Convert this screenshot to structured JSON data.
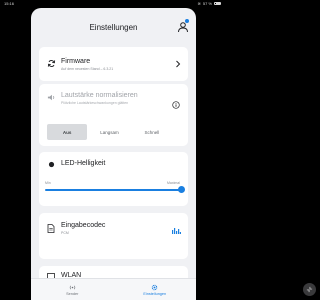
{
  "status_bar": {
    "time": "15:16",
    "battery": "57 %"
  },
  "header": {
    "title": "Einstellungen"
  },
  "firmware": {
    "title": "Firmware",
    "subtitle": "Auf dem neuesten Stand – 6.3.21"
  },
  "normalize": {
    "title": "Lautstärke normalisieren",
    "subtitle": "Plötzliche Lautstärkeschwankungen glätten",
    "options": [
      "Aus",
      "Langsam",
      "Schnell"
    ],
    "selected": "Aus"
  },
  "led": {
    "title": "LED-Helligkeit",
    "min_label": "Min",
    "max_label": "Maximal",
    "level": 1.0
  },
  "codec": {
    "title": "Eingabecodec",
    "subtitle": "PCM"
  },
  "next_card": {
    "title": "WLAN"
  },
  "bottom_nav": {
    "items": [
      "Sender",
      "Einstellungen"
    ],
    "active": "Einstellungen"
  },
  "colors": {
    "accent": "#1a7fe0",
    "background": "#f0f1f4",
    "card": "#ffffff"
  }
}
